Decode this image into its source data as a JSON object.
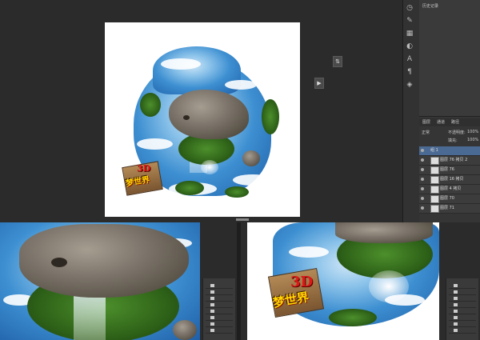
{
  "history_panel": {
    "header": "历史记录"
  },
  "layers_panel": {
    "tabs": [
      "图层",
      "通道",
      "路径"
    ],
    "blend_mode": "正常",
    "opacity_label": "不透明度:",
    "opacity_value": "100%",
    "fill_label": "填充:",
    "fill_value": "100%",
    "group_name": "组 1",
    "layers": [
      {
        "name": "图层 76 拷贝 2",
        "selected": false
      },
      {
        "name": "图层 76",
        "selected": false
      },
      {
        "name": "图层 16 拷贝",
        "selected": false
      },
      {
        "name": "图层 4 拷贝",
        "selected": false
      },
      {
        "name": "图层 70",
        "selected": false
      },
      {
        "name": "图层 71",
        "selected": false
      }
    ]
  },
  "canvas": {
    "sign_3d": "3D",
    "sign_text": "梦世界"
  },
  "colors": {
    "workspace": "#2b2b2b",
    "panel": "#353535",
    "sky": "#3d8fd1",
    "sign_yellow": "#ffd900"
  },
  "icons": [
    "history-icon",
    "brush-icon",
    "swatches-icon",
    "adjust-icon",
    "type-icon",
    "paragraph-icon",
    "layers-icon"
  ]
}
